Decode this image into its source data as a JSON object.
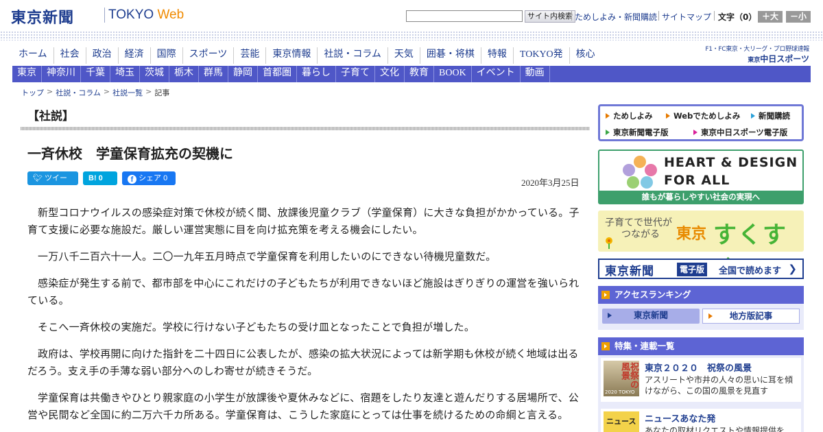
{
  "header": {
    "logo_jp": "東京新聞",
    "logo_en_a": "TOKYO",
    "logo_en_b": "Web",
    "search_button": "サイト内検索",
    "links": [
      "ためしよみ・新聞購読",
      "サイトマップ"
    ],
    "font_size_label": "文字（0）",
    "font_larger": "＋大",
    "font_smaller": "－小"
  },
  "main_nav": [
    "ホーム",
    "社会",
    "政治",
    "経済",
    "国際",
    "スポーツ",
    "芸能",
    "東京情報",
    "社説・コラム",
    "天気",
    "囲碁・将棋",
    "特報",
    "TOKYO発",
    "核心"
  ],
  "sports_promo": {
    "line1": "F1・FC東京・大リーグ・プロ野球速報",
    "line2_small": "東京",
    "line2": "中日スポーツ"
  },
  "region_nav": [
    "東京",
    "神奈川",
    "千葉",
    "埼玉",
    "茨城",
    "栃木",
    "群馬",
    "静岡",
    "首都圏",
    "暮らし",
    "子育て",
    "文化",
    "教育",
    "BOOK",
    "イベント",
    "動画"
  ],
  "breadcrumb": [
    "トップ",
    "社説・コラム",
    "社説一覧",
    "記事"
  ],
  "article": {
    "section": "【社説】",
    "title": "一斉休校　学童保育拡充の契機に",
    "date": "2020年3月25日",
    "share": {
      "tweet": "ツイート",
      "hatena": "B! 0",
      "facebook": "シェア 0"
    },
    "paragraphs": [
      "新型コロナウイルスの感染症対策で休校が続く間、放課後児童クラブ（学童保育）に大きな負担がかかっている。子育て支援に必要な施設だ。厳しい運営実態に目を向け拡充策を考える機会にしたい。",
      "一万八千二百六十一人。二〇一九年五月時点で学童保育を利用したいのにできない待機児童数だ。",
      "感染症が発生する前で、都市部を中心にこれだけの子どもたちが利用できないほど施設はぎりぎりの運営を強いられている。",
      "そこへ一斉休校の実施だ。学校に行けない子どもたちの受け皿となったことで負担が増した。",
      "政府は、学校再開に向けた指針を二十四日に公表したが、感染の拡大状況によっては新学期も休校が続く地域は出るだろう。支え手の手薄な弱い部分へのしわ寄せが続きそうだ。",
      "学童保育は共働きやひとり親家庭の小学生が放課後や夏休みなどに、宿題をしたり友達と遊んだりする居場所で、公営や民間など全国に約二万六千カ所ある。学童保育は、こうした家庭にとっては仕事を続けるための命綱と言える。"
    ]
  },
  "sidebar": {
    "quick_links": [
      "ためしよみ",
      "Webでためしよみ",
      "新聞購読",
      "東京新聞電子版",
      "東京中日スポーツ電子版"
    ],
    "heart_design": {
      "line1": "HEART & DESIGN",
      "line2": "FOR ALL",
      "caption": "誰もが暮らしやすい社会の実現へ"
    },
    "sukusuku": {
      "line1": "子育てで世代が",
      "line2": "つながる",
      "brand_small": "東京",
      "brand": "すくすく"
    },
    "digital": {
      "logo": "東京新聞",
      "tag": "電子版",
      "text": "全国で読めます"
    },
    "ranking": {
      "title": "アクセスランキング",
      "tabs": [
        "東京新聞",
        "地方版記事"
      ]
    },
    "features": {
      "title": "特集・連載一覧",
      "items": [
        {
          "title": "東京２０２０　祝祭の風景",
          "desc": "アスリートや市井の人々の思いに耳を傾けながら、この国の風景を見直す",
          "thumb_text": "祝祭の風景",
          "thumb_caption": "2020 TOKYO"
        },
        {
          "title": "ニュースあなた発",
          "desc": "あなたの取材リクエストや情報提供を",
          "thumb_text": "ニュース"
        }
      ]
    }
  },
  "colors": {
    "brand_blue": "#1e3d8f",
    "nav_purple": "#4f57c7",
    "accent_orange": "#f08a00",
    "green": "#3d9f6c"
  }
}
